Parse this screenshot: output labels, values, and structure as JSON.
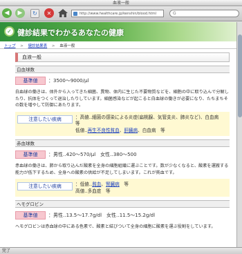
{
  "window": {
    "title": "血液一般"
  },
  "toolbar": {
    "back_glyph": "◀",
    "forward_glyph": "▶",
    "reload_glyph": "↻",
    "stop_glyph": "✕",
    "address": "http://www.healthcare.jp/kenshin/blood.html",
    "search_prefix": "G"
  },
  "banner": {
    "logo_glyph": "✓",
    "title": "健診結果でわかるあなたの健康"
  },
  "breadcrumb": {
    "home": "トップ",
    "results": "健診結果表",
    "current": "血液一般",
    "sep": ">"
  },
  "main": {
    "title": "血液一般",
    "wbc": {
      "heading": "白血球数",
      "ref_label": "基準値",
      "ref_value": "：3500〜9000/μl",
      "desc": "白血球の働きは、体外から入ってきた細菌、異物、体内に生じた不要物質などを、細胞の中に取り込んで分解したり、抗体をつくって退治したりしています。細菌感染などが起こると白血球の働きが必要になり、たちまちその数を増やして防御にあたります。",
      "dis_label": "注意したい疾病",
      "dis_high": "：高値‥細菌の感染による炎症(扁桃腺、気管支炎、肺炎など)、白血病　等",
      "dis_low_prefix": "低値‥",
      "dis_low_link1": "再生不良性貧血",
      "dis_low_mid": "、",
      "dis_low_link2": "肝臓病",
      "dis_low_suffix": "、白血病　等"
    },
    "rbc": {
      "heading": "赤血球数",
      "ref_label": "基準値",
      "ref_value": "：男性‥420〜570/μl　女性‥380〜500",
      "desc": "赤血球の働きは、肺から取り込んだ酸素を全身の細胞組織に運ぶことです。数が少なくなると、酸素を運搬する能力が低下するため、全身への酸素の供給が不足してしまいます。これが貧血です。",
      "dis_label": "注意したい疾病",
      "dis_low_prefix": "：低値‥",
      "dis_low_link1": "貧血",
      "dis_low_mid": "、",
      "dis_low_link2": "腎臓病",
      "dis_low_suffix": "　等",
      "dis_high": "高値‥多血症　等"
    },
    "hb": {
      "heading": "ヘモグロビン",
      "ref_label": "基準値",
      "ref_value": "：男性‥13.5〜17.7g/dl　女性‥11.5〜15.2g/dl",
      "desc": "ヘモグロビンは赤血球の中にある色素で、酸素と結びついて全身の細胞に酸素を運ぶ役割をしています。"
    }
  },
  "status": {
    "text": "完了"
  }
}
